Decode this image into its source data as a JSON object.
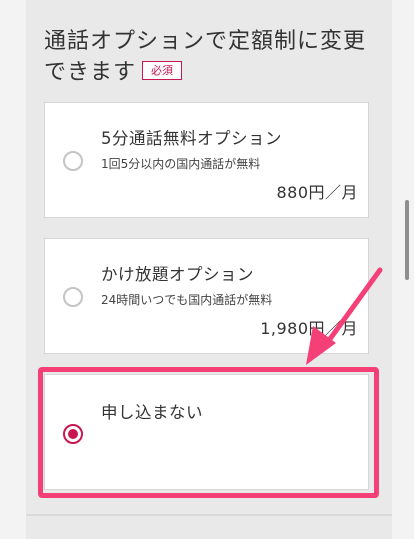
{
  "form": {
    "heading": "通話オプションで定額制に変更できます",
    "required_badge": "必須",
    "accent_color": "#c8174f",
    "highlight_color": "#f43f77"
  },
  "options": [
    {
      "title": "5分通話無料オプション",
      "description": "1回5分以内の国内通話が無料",
      "price": "880円／月",
      "selected": false
    },
    {
      "title": "かけ放題オプション",
      "description": "24時間いつでも国内通話が無料",
      "price": "1,980円／月",
      "selected": false
    },
    {
      "title": "申し込まない",
      "selected": true
    }
  ],
  "annotation": {
    "arrow_icon": "arrow-pointing-down-left-icon"
  }
}
